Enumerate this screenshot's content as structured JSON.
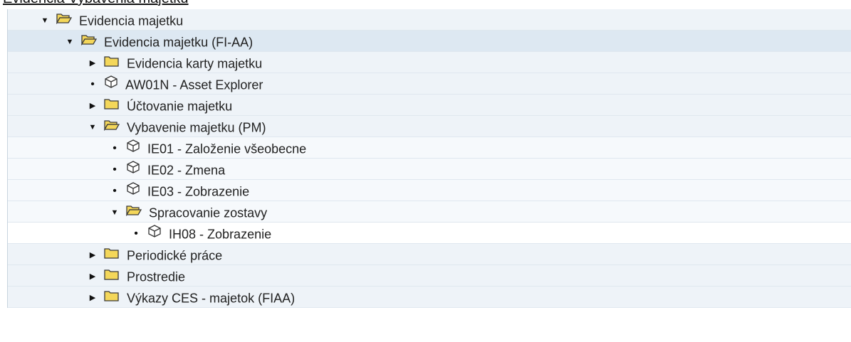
{
  "caption": "Evidencia Vybavenia majetku",
  "tree": [
    {
      "label": "Evidencia majetku",
      "state": "expanded",
      "icon": "folder-open-icon"
    },
    {
      "label": "Evidencia majetku (FI-AA)",
      "state": "expanded",
      "icon": "folder-open-icon"
    },
    {
      "label": "Evidencia karty majetku",
      "state": "collapsed",
      "icon": "folder-icon"
    },
    {
      "label": "AW01N - Asset Explorer",
      "state": "leaf",
      "icon": "transaction-cube-icon"
    },
    {
      "label": "Účtovanie majetku",
      "state": "collapsed",
      "icon": "folder-icon"
    },
    {
      "label": "Vybavenie majetku (PM)",
      "state": "expanded",
      "icon": "folder-open-icon"
    },
    {
      "label": "IE01 - Založenie všeobecne",
      "state": "leaf",
      "icon": "transaction-cube-icon"
    },
    {
      "label": "IE02 - Zmena",
      "state": "leaf",
      "icon": "transaction-cube-icon"
    },
    {
      "label": "IE03 - Zobrazenie",
      "state": "leaf",
      "icon": "transaction-cube-icon"
    },
    {
      "label": "Spracovanie zostavy",
      "state": "expanded",
      "icon": "folder-open-icon"
    },
    {
      "label": "IH08 - Zobrazenie",
      "state": "leaf",
      "icon": "transaction-cube-icon"
    },
    {
      "label": "Periodické práce",
      "state": "collapsed",
      "icon": "folder-icon"
    },
    {
      "label": "Prostredie",
      "state": "collapsed",
      "icon": "folder-icon"
    },
    {
      "label": "Výkazy CES - majetok (FIAA)",
      "state": "collapsed",
      "icon": "folder-icon"
    }
  ],
  "glyphs": {
    "expanded": "▼",
    "collapsed": "▶",
    "leaf": "•"
  },
  "colors": {
    "folder_fill": "#f4d75a",
    "folder_stroke": "#3a3a3a",
    "row_alt": "#dde8f2"
  }
}
